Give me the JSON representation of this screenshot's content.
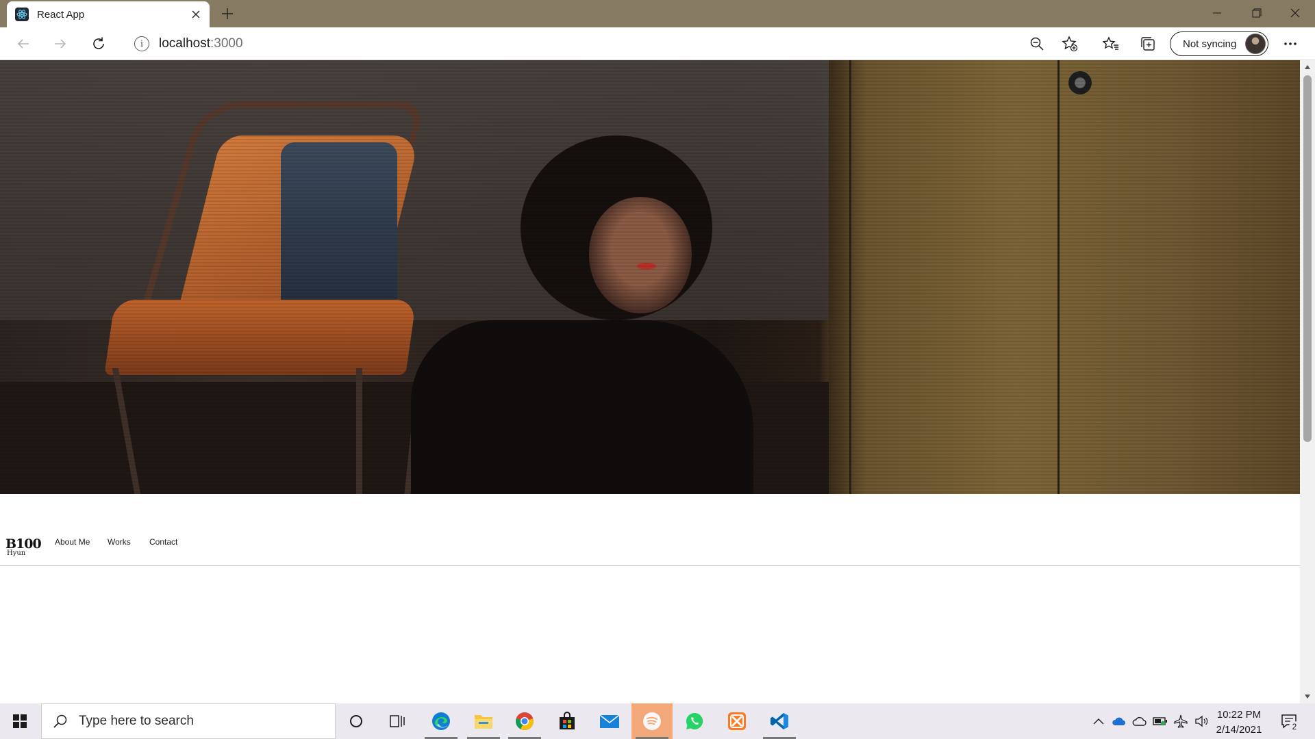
{
  "browser": {
    "tab_title": "React App",
    "address_host": "localhost",
    "address_port": ":3000",
    "sync_label": "Not syncing"
  },
  "site": {
    "logo_text": "B100",
    "logo_sub": "Hyun",
    "nav_links": [
      "About Me",
      "Works",
      "Contact"
    ]
  },
  "taskbar": {
    "search_placeholder": "Type here to search",
    "apps": [
      "cortana-icon",
      "task-view-icon",
      "edge-icon",
      "file-explorer-icon",
      "chrome-icon",
      "store-icon",
      "mail-icon",
      "spotify-icon",
      "whatsapp-icon",
      "xampp-icon",
      "vscode-icon"
    ],
    "active_app": "spotify-icon",
    "clock_time": "10:22 PM",
    "clock_date": "2/14/2021",
    "notification_count": "2"
  },
  "colors": {
    "tab_strip": "#877a63",
    "taskbar": "#ece8f0",
    "active_app_highlight": "#f2a878"
  }
}
